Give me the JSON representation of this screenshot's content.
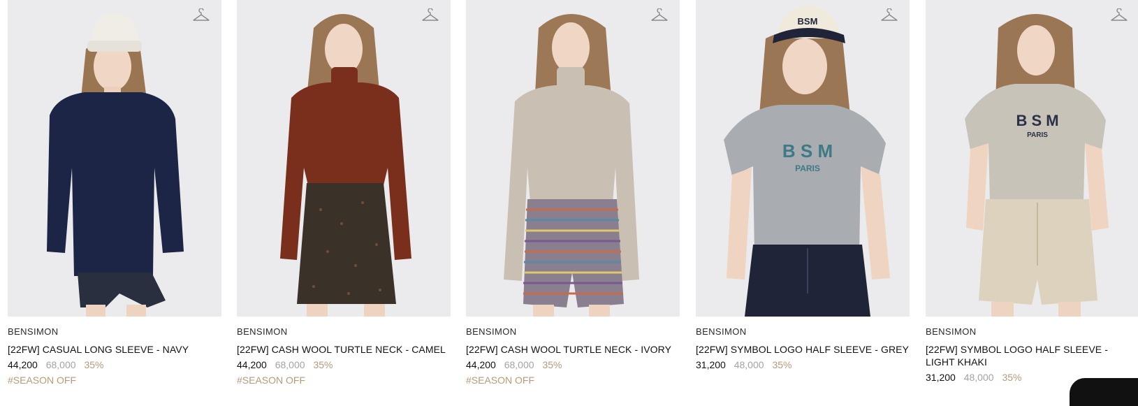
{
  "products": [
    {
      "brand": "BENSIMON",
      "title": "[22FW] CASUAL LONG SLEEVE - NAVY",
      "price": "44,200",
      "original_price": "68,000",
      "discount": "35%",
      "tag": "#SEASON OFF",
      "top_color": "#1c2545",
      "bottom_color": "#2a2f3f",
      "hat_color": "#f0ede6"
    },
    {
      "brand": "BENSIMON",
      "title": "[22FW] CASH WOOL TURTLE NECK - CAMEL",
      "price": "44,200",
      "original_price": "68,000",
      "discount": "35%",
      "tag": "#SEASON OFF",
      "top_color": "#7a2e1c",
      "bottom_color": "#3a3128"
    },
    {
      "brand": "BENSIMON",
      "title": "[22FW] CASH WOOL TURTLE NECK - IVORY",
      "price": "44,200",
      "original_price": "68,000",
      "discount": "35%",
      "tag": "#SEASON OFF",
      "top_color": "#c9bfb2",
      "bottom_color": "#8a7f8e"
    },
    {
      "brand": "BENSIMON",
      "title": "[22FW] SYMBOL LOGO HALF SLEEVE - GREY",
      "price": "31,200",
      "original_price": "48,000",
      "discount": "35%",
      "tag": "",
      "top_color": "#a9acb0",
      "bottom_color": "#1f2438",
      "logo_text": "B S M",
      "logo_sub": "PARIS",
      "logo_color": "#3d7a86",
      "cap_text": "BSM"
    },
    {
      "brand": "BENSIMON",
      "title": "[22FW] SYMBOL LOGO HALF SLEEVE - LIGHT KHAKI",
      "price": "31,200",
      "original_price": "48,000",
      "discount": "35%",
      "tag": "",
      "top_color": "#c8c3b8",
      "bottom_color": "#ddd2bd",
      "logo_text": "B S M",
      "logo_sub": "PARIS",
      "logo_color": "#2b3046"
    }
  ],
  "icons": {
    "wishlist": "hanger-icon"
  },
  "colors": {
    "discount": "#b59a7b",
    "original_price": "#a3a3a3",
    "photo_bg": "#ebebed"
  }
}
